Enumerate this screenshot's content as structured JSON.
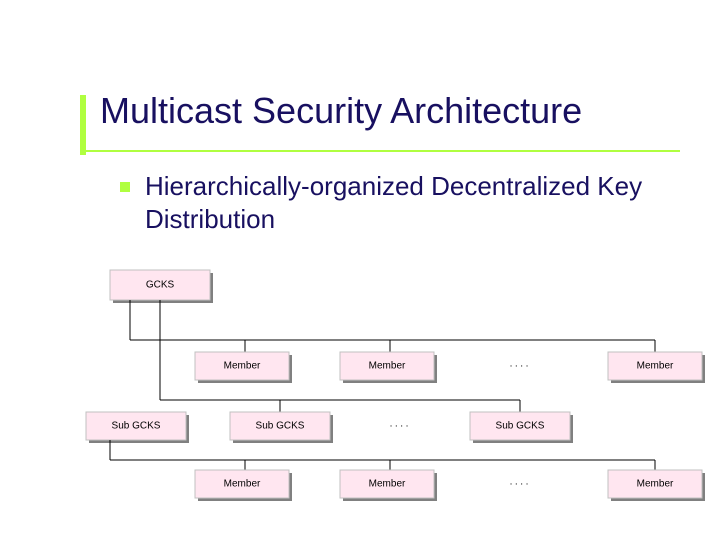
{
  "title": "Multicast Security Architecture",
  "subtitle": "Hierarchically-organized Decentralized Key Distribution",
  "diagram": {
    "gcks": "GCKS",
    "row2": {
      "m1": "Member",
      "m2": "Member",
      "dots": "····",
      "m3": "Member"
    },
    "row3": {
      "s1": "Sub GCKS",
      "s2": "Sub GCKS",
      "dots": "····",
      "s3": "Sub GCKS"
    },
    "row4": {
      "m1": "Member",
      "m2": "Member",
      "dots": "····",
      "m3": "Member"
    }
  }
}
